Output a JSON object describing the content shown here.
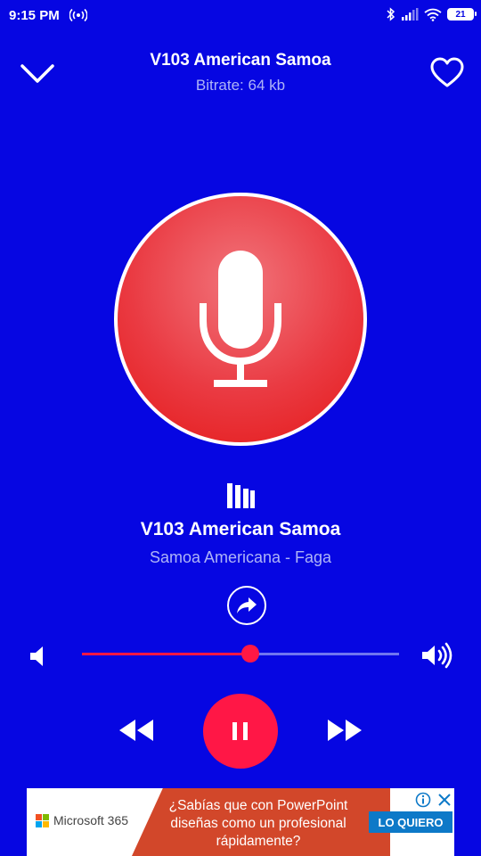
{
  "status_bar": {
    "time": "9:15 PM",
    "battery": "21",
    "icons": [
      "hotspot-icon",
      "bluetooth-icon",
      "signal-icon",
      "wifi-icon",
      "battery-icon"
    ]
  },
  "header": {
    "title": "V103 American Samoa",
    "subtitle": "Bitrate: 64 kb",
    "back_icon": "chevron-down-icon",
    "favorite_icon": "heart-icon"
  },
  "artwork": {
    "icon": "microphone-icon"
  },
  "now_playing": {
    "station_name": "V103 American Samoa",
    "location": "Samoa Americana - Faga",
    "eq_icon": "equalizer-icon",
    "share_icon": "share-icon"
  },
  "volume": {
    "level": 0.53
  },
  "controls": {
    "rewind_icon": "rewind-icon",
    "pause_icon": "pause-icon",
    "forward_icon": "fast-forward-icon"
  },
  "ad": {
    "brand": "Microsoft 365",
    "text": "¿Sabías que con PowerPoint diseñas como un profesional rápidamente?",
    "cta": "LO QUIERO"
  },
  "colors": {
    "background": "#0606e2",
    "accent": "#ff1746",
    "muted_text": "#aeb4f7"
  }
}
